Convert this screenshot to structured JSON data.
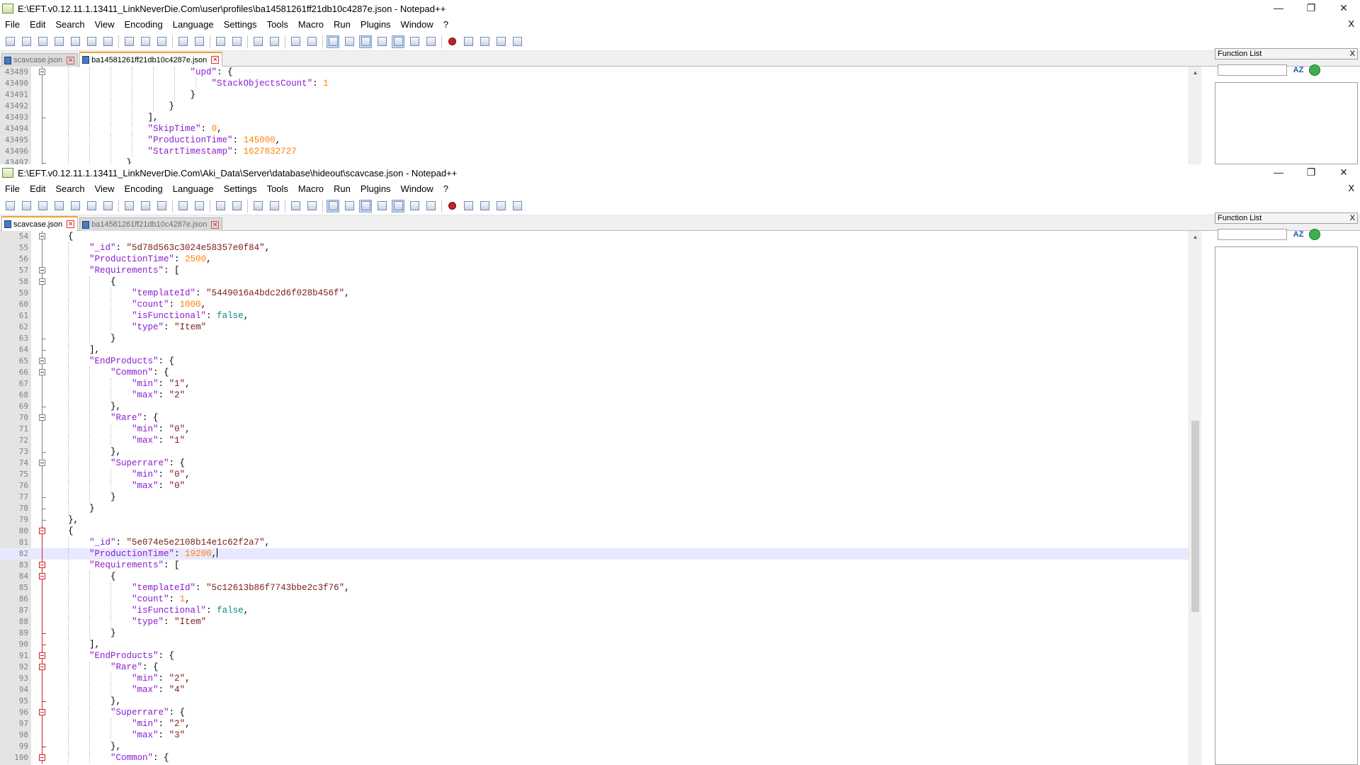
{
  "colors": {
    "keyword": "#8a1bd0",
    "string": "#7a1c1c",
    "number": "#ff8000",
    "boolean": "#0a8a8a",
    "tab_accent": "#f3a12b",
    "fold_active": "#d0202a"
  },
  "menu": [
    "File",
    "Edit",
    "Search",
    "View",
    "Encoding",
    "Language",
    "Settings",
    "Tools",
    "Macro",
    "Run",
    "Plugins",
    "Window",
    "?"
  ],
  "menu_close_label": "X",
  "window_controls": {
    "minimize": "—",
    "restore": "❐",
    "close": "✕"
  },
  "toolbar_icons": [
    "new-file-icon",
    "open-file-icon",
    "save-icon",
    "save-all-icon",
    "close-icon",
    "close-all-icon",
    "print-icon",
    "|",
    "cut-icon",
    "copy-icon",
    "paste-icon",
    "|",
    "undo-icon",
    "redo-icon",
    "|",
    "find-icon",
    "replace-icon",
    "|",
    "zoom-in-icon",
    "zoom-out-icon",
    "|",
    "sync-vertical-icon",
    "sync-horizontal-icon",
    "|",
    "word-wrap-icon",
    "show-all-chars-icon",
    "indent-guide-icon",
    "udl-icon",
    "function-list-icon",
    "folder-workspace-icon",
    "monitoring-icon",
    "|",
    "record-macro-icon",
    "stop-macro-icon",
    "play-macro-icon",
    "run-macro-multiple-icon",
    "save-macro-icon"
  ],
  "window1": {
    "title": "E:\\EFT.v0.12.11.1.13411_LinkNeverDie.Com\\user\\profiles\\ba14581261ff21db10c4287e.json - Notepad++",
    "tabs": [
      {
        "label": "scavcase.json",
        "active": false
      },
      {
        "label": "ba14581261ff21db10c4287e.json",
        "active": true
      }
    ],
    "function_list_title": "Function List",
    "function_list_close": "X",
    "sort_label": "AZ",
    "lines": [
      {
        "num": "43489",
        "fold": "box",
        "indent": 27,
        "code": [
          [
            "k",
            "\"upd\""
          ],
          [
            "p",
            ": {"
          ]
        ]
      },
      {
        "num": "43490",
        "fold": "line",
        "indent": 31,
        "code": [
          [
            "k",
            "\"StackObjectsCount\""
          ],
          [
            "p",
            ": "
          ],
          [
            "n",
            "1"
          ]
        ]
      },
      {
        "num": "43491",
        "fold": "line",
        "indent": 27,
        "code": [
          [
            "p",
            "}"
          ]
        ]
      },
      {
        "num": "43492",
        "fold": "line",
        "indent": 23,
        "code": [
          [
            "p",
            "}"
          ]
        ]
      },
      {
        "num": "43493",
        "fold": "end",
        "indent": 19,
        "code": [
          [
            "p",
            "],"
          ]
        ]
      },
      {
        "num": "43494",
        "fold": "line",
        "indent": 19,
        "code": [
          [
            "k",
            "\"SkipTime\""
          ],
          [
            "p",
            ": "
          ],
          [
            "n",
            "0"
          ],
          [
            "p",
            ","
          ]
        ]
      },
      {
        "num": "43495",
        "fold": "line",
        "indent": 19,
        "code": [
          [
            "k",
            "\"ProductionTime\""
          ],
          [
            "p",
            ": "
          ],
          [
            "n",
            "145000"
          ],
          [
            "p",
            ","
          ]
        ]
      },
      {
        "num": "43496",
        "fold": "line",
        "indent": 19,
        "code": [
          [
            "k",
            "\"StartTimestamp\""
          ],
          [
            "p",
            ": "
          ],
          [
            "n",
            "1627832727"
          ]
        ]
      },
      {
        "num": "43497",
        "fold": "end",
        "indent": 15,
        "code": [
          [
            "p",
            "}"
          ]
        ]
      }
    ]
  },
  "window2": {
    "title": "E:\\EFT.v0.12.11.1.13411_LinkNeverDie.Com\\Aki_Data\\Server\\database\\hideout\\scavcase.json - Notepad++",
    "tabs": [
      {
        "label": "scavcase.json",
        "active": true
      },
      {
        "label": "ba14581261ff21db10c4287e.json",
        "active": false
      }
    ],
    "function_list_title": "Function List",
    "function_list_close": "X",
    "sort_label": "AZ",
    "lines": [
      {
        "num": "54",
        "fold": "box",
        "indent": 4,
        "code": [
          [
            "p",
            "{"
          ]
        ]
      },
      {
        "num": "55",
        "fold": "line",
        "indent": 8,
        "code": [
          [
            "k",
            "\"_id\""
          ],
          [
            "p",
            ": "
          ],
          [
            "s",
            "\"5d78d563c3024e58357e0f84\""
          ],
          [
            "p",
            ","
          ]
        ]
      },
      {
        "num": "56",
        "fold": "line",
        "indent": 8,
        "code": [
          [
            "k",
            "\"ProductionTime\""
          ],
          [
            "p",
            ": "
          ],
          [
            "n",
            "2500"
          ],
          [
            "p",
            ","
          ]
        ]
      },
      {
        "num": "57",
        "fold": "box",
        "indent": 8,
        "code": [
          [
            "k",
            "\"Requirements\""
          ],
          [
            "p",
            ": ["
          ]
        ]
      },
      {
        "num": "58",
        "fold": "box",
        "indent": 12,
        "code": [
          [
            "p",
            "{"
          ]
        ]
      },
      {
        "num": "59",
        "fold": "line",
        "indent": 16,
        "code": [
          [
            "k",
            "\"templateId\""
          ],
          [
            "p",
            ": "
          ],
          [
            "s",
            "\"5449016a4bdc2d6f028b456f\""
          ],
          [
            "p",
            ","
          ]
        ]
      },
      {
        "num": "60",
        "fold": "line",
        "indent": 16,
        "code": [
          [
            "k",
            "\"count\""
          ],
          [
            "p",
            ": "
          ],
          [
            "n",
            "1000"
          ],
          [
            "p",
            ","
          ]
        ]
      },
      {
        "num": "61",
        "fold": "line",
        "indent": 16,
        "code": [
          [
            "k",
            "\"isFunctional\""
          ],
          [
            "p",
            ": "
          ],
          [
            "b",
            "false"
          ],
          [
            "p",
            ","
          ]
        ]
      },
      {
        "num": "62",
        "fold": "line",
        "indent": 16,
        "code": [
          [
            "k",
            "\"type\""
          ],
          [
            "p",
            ": "
          ],
          [
            "s",
            "\"Item\""
          ]
        ]
      },
      {
        "num": "63",
        "fold": "end",
        "indent": 12,
        "code": [
          [
            "p",
            "}"
          ]
        ]
      },
      {
        "num": "64",
        "fold": "end",
        "indent": 8,
        "code": [
          [
            "p",
            "],"
          ]
        ]
      },
      {
        "num": "65",
        "fold": "box",
        "indent": 8,
        "code": [
          [
            "k",
            "\"EndProducts\""
          ],
          [
            "p",
            ": {"
          ]
        ]
      },
      {
        "num": "66",
        "fold": "box",
        "indent": 12,
        "code": [
          [
            "k",
            "\"Common\""
          ],
          [
            "p",
            ": {"
          ]
        ]
      },
      {
        "num": "67",
        "fold": "line",
        "indent": 16,
        "code": [
          [
            "k",
            "\"min\""
          ],
          [
            "p",
            ": "
          ],
          [
            "s",
            "\"1\""
          ],
          [
            "p",
            ","
          ]
        ]
      },
      {
        "num": "68",
        "fold": "line",
        "indent": 16,
        "code": [
          [
            "k",
            "\"max\""
          ],
          [
            "p",
            ": "
          ],
          [
            "s",
            "\"2\""
          ]
        ]
      },
      {
        "num": "69",
        "fold": "end",
        "indent": 12,
        "code": [
          [
            "p",
            "},"
          ]
        ]
      },
      {
        "num": "70",
        "fold": "box",
        "indent": 12,
        "code": [
          [
            "k",
            "\"Rare\""
          ],
          [
            "p",
            ": {"
          ]
        ]
      },
      {
        "num": "71",
        "fold": "line",
        "indent": 16,
        "code": [
          [
            "k",
            "\"min\""
          ],
          [
            "p",
            ": "
          ],
          [
            "s",
            "\"0\""
          ],
          [
            "p",
            ","
          ]
        ]
      },
      {
        "num": "72",
        "fold": "line",
        "indent": 16,
        "code": [
          [
            "k",
            "\"max\""
          ],
          [
            "p",
            ": "
          ],
          [
            "s",
            "\"1\""
          ]
        ]
      },
      {
        "num": "73",
        "fold": "end",
        "indent": 12,
        "code": [
          [
            "p",
            "},"
          ]
        ]
      },
      {
        "num": "74",
        "fold": "box",
        "indent": 12,
        "code": [
          [
            "k",
            "\"Superrare\""
          ],
          [
            "p",
            ": {"
          ]
        ]
      },
      {
        "num": "75",
        "fold": "line",
        "indent": 16,
        "code": [
          [
            "k",
            "\"min\""
          ],
          [
            "p",
            ": "
          ],
          [
            "s",
            "\"0\""
          ],
          [
            "p",
            ","
          ]
        ]
      },
      {
        "num": "76",
        "fold": "line",
        "indent": 16,
        "code": [
          [
            "k",
            "\"max\""
          ],
          [
            "p",
            ": "
          ],
          [
            "s",
            "\"0\""
          ]
        ]
      },
      {
        "num": "77",
        "fold": "end",
        "indent": 12,
        "code": [
          [
            "p",
            "}"
          ]
        ]
      },
      {
        "num": "78",
        "fold": "end",
        "indent": 8,
        "code": [
          [
            "p",
            "}"
          ]
        ]
      },
      {
        "num": "79",
        "fold": "end",
        "indent": 4,
        "code": [
          [
            "p",
            "},"
          ]
        ]
      },
      {
        "num": "80",
        "fold": "redbox",
        "indent": 4,
        "code": [
          [
            "p",
            "{"
          ]
        ]
      },
      {
        "num": "81",
        "fold": "redline",
        "indent": 8,
        "code": [
          [
            "k",
            "\"_id\""
          ],
          [
            "p",
            ": "
          ],
          [
            "s",
            "\"5e074e5e2108b14e1c62f2a7\""
          ],
          [
            "p",
            ","
          ]
        ]
      },
      {
        "num": "82",
        "fold": "redline",
        "indent": 8,
        "current": true,
        "code": [
          [
            "k",
            "\"ProductionTime\""
          ],
          [
            "p",
            ": "
          ],
          [
            "n",
            "19200"
          ],
          [
            "p",
            ","
          ]
        ]
      },
      {
        "num": "83",
        "fold": "redbox",
        "indent": 8,
        "code": [
          [
            "k",
            "\"Requirements\""
          ],
          [
            "p",
            ": ["
          ]
        ]
      },
      {
        "num": "84",
        "fold": "redbox",
        "indent": 12,
        "code": [
          [
            "p",
            "{"
          ]
        ]
      },
      {
        "num": "85",
        "fold": "redline",
        "indent": 16,
        "code": [
          [
            "k",
            "\"templateId\""
          ],
          [
            "p",
            ": "
          ],
          [
            "s",
            "\"5c12613b86f7743bbe2c3f76\""
          ],
          [
            "p",
            ","
          ]
        ]
      },
      {
        "num": "86",
        "fold": "redline",
        "indent": 16,
        "code": [
          [
            "k",
            "\"count\""
          ],
          [
            "p",
            ": "
          ],
          [
            "n",
            "1"
          ],
          [
            "p",
            ","
          ]
        ]
      },
      {
        "num": "87",
        "fold": "redline",
        "indent": 16,
        "code": [
          [
            "k",
            "\"isFunctional\""
          ],
          [
            "p",
            ": "
          ],
          [
            "b",
            "false"
          ],
          [
            "p",
            ","
          ]
        ]
      },
      {
        "num": "88",
        "fold": "redline",
        "indent": 16,
        "code": [
          [
            "k",
            "\"type\""
          ],
          [
            "p",
            ": "
          ],
          [
            "s",
            "\"Item\""
          ]
        ]
      },
      {
        "num": "89",
        "fold": "redend",
        "indent": 12,
        "code": [
          [
            "p",
            "}"
          ]
        ]
      },
      {
        "num": "90",
        "fold": "redend",
        "indent": 8,
        "code": [
          [
            "p",
            "],"
          ]
        ]
      },
      {
        "num": "91",
        "fold": "redbox",
        "indent": 8,
        "code": [
          [
            "k",
            "\"EndProducts\""
          ],
          [
            "p",
            ": {"
          ]
        ]
      },
      {
        "num": "92",
        "fold": "redbox",
        "indent": 12,
        "code": [
          [
            "k",
            "\"Rare\""
          ],
          [
            "p",
            ": {"
          ]
        ]
      },
      {
        "num": "93",
        "fold": "redline",
        "indent": 16,
        "code": [
          [
            "k",
            "\"min\""
          ],
          [
            "p",
            ": "
          ],
          [
            "s",
            "\"2\""
          ],
          [
            "p",
            ","
          ]
        ]
      },
      {
        "num": "94",
        "fold": "redline",
        "indent": 16,
        "code": [
          [
            "k",
            "\"max\""
          ],
          [
            "p",
            ": "
          ],
          [
            "s",
            "\"4\""
          ]
        ]
      },
      {
        "num": "95",
        "fold": "redend",
        "indent": 12,
        "code": [
          [
            "p",
            "},"
          ]
        ]
      },
      {
        "num": "96",
        "fold": "redbox",
        "indent": 12,
        "code": [
          [
            "k",
            "\"Superrare\""
          ],
          [
            "p",
            ": {"
          ]
        ]
      },
      {
        "num": "97",
        "fold": "redline",
        "indent": 16,
        "code": [
          [
            "k",
            "\"min\""
          ],
          [
            "p",
            ": "
          ],
          [
            "s",
            "\"2\""
          ],
          [
            "p",
            ","
          ]
        ]
      },
      {
        "num": "98",
        "fold": "redline",
        "indent": 16,
        "code": [
          [
            "k",
            "\"max\""
          ],
          [
            "p",
            ": "
          ],
          [
            "s",
            "\"3\""
          ]
        ]
      },
      {
        "num": "99",
        "fold": "redend",
        "indent": 12,
        "code": [
          [
            "p",
            "},"
          ]
        ]
      },
      {
        "num": "100",
        "fold": "redbox",
        "indent": 12,
        "code": [
          [
            "k",
            "\"Common\""
          ],
          [
            "p",
            ": {"
          ]
        ]
      }
    ]
  }
}
